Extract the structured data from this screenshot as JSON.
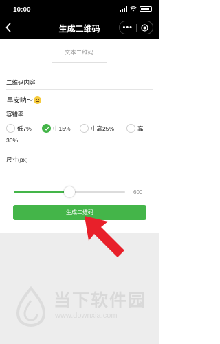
{
  "status_bar": {
    "time": "10:00"
  },
  "nav": {
    "title": "生成二维码",
    "more_icon": "more-dots-icon",
    "close_icon": "target-close-icon"
  },
  "tab": {
    "label": "文本二维码"
  },
  "content": {
    "label": "二维码内容",
    "value": "早安呐～"
  },
  "error_correction": {
    "label": "容错率",
    "options": [
      {
        "label": "低7%",
        "selected": false
      },
      {
        "label": "中15%",
        "selected": true
      },
      {
        "label": "中高25%",
        "selected": false
      },
      {
        "label": "高",
        "selected": false
      }
    ],
    "wrap_text": "30%"
  },
  "size": {
    "label": "尺寸(px)",
    "value": 600,
    "slider_fraction": 0.5
  },
  "button": {
    "label": "生成二维码"
  },
  "watermark": {
    "title": "当下软件园",
    "url": "www.downxia.com"
  },
  "colors": {
    "accent": "#44b549",
    "annotation": "#e8202a"
  }
}
